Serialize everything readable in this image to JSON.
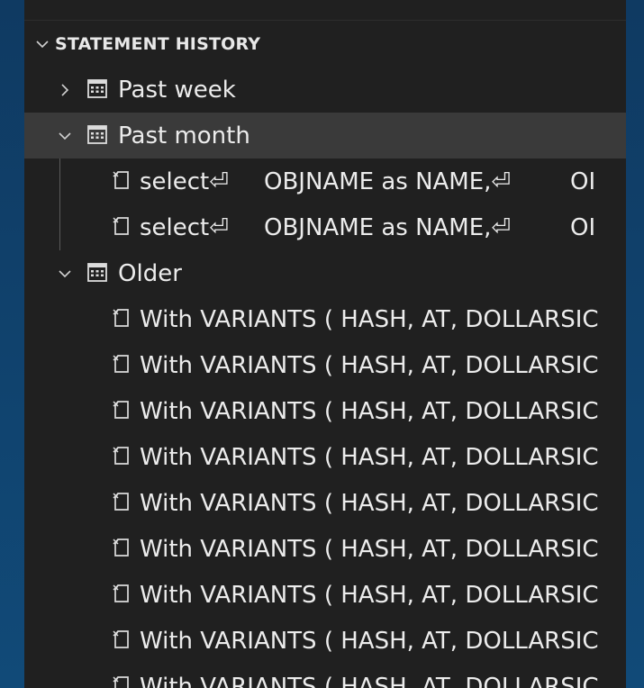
{
  "header": {
    "title": "STATEMENT HISTORY"
  },
  "groups": {
    "past_week": {
      "label": "Past week"
    },
    "past_month": {
      "label": "Past month",
      "items": [
        {
          "col1": "select⏎",
          "col2": "OBJNAME as NAME,⏎",
          "col3": "OI"
        },
        {
          "col1": "select⏎",
          "col2": "OBJNAME as NAME,⏎",
          "col3": "OI"
        }
      ]
    },
    "older": {
      "label": "Older",
      "items": [
        {
          "text": "With VARIANTS ( HASH, AT, DOLLARSIC"
        },
        {
          "text": "With VARIANTS ( HASH, AT, DOLLARSIC"
        },
        {
          "text": "With VARIANTS ( HASH, AT, DOLLARSIC"
        },
        {
          "text": "With VARIANTS ( HASH, AT, DOLLARSIC"
        },
        {
          "text": "With VARIANTS ( HASH, AT, DOLLARSIC"
        },
        {
          "text": "With VARIANTS ( HASH, AT, DOLLARSIC"
        },
        {
          "text": "With VARIANTS ( HASH, AT, DOLLARSIC"
        },
        {
          "text": "With VARIANTS ( HASH, AT, DOLLARSIC"
        },
        {
          "text": "With VARIANTS ( HASH, AT, DOLLARSIC"
        }
      ]
    }
  },
  "colors": {
    "panel": "#202020",
    "selected": "#3a3a3a",
    "text": "#ececec",
    "background": "#114a78"
  }
}
